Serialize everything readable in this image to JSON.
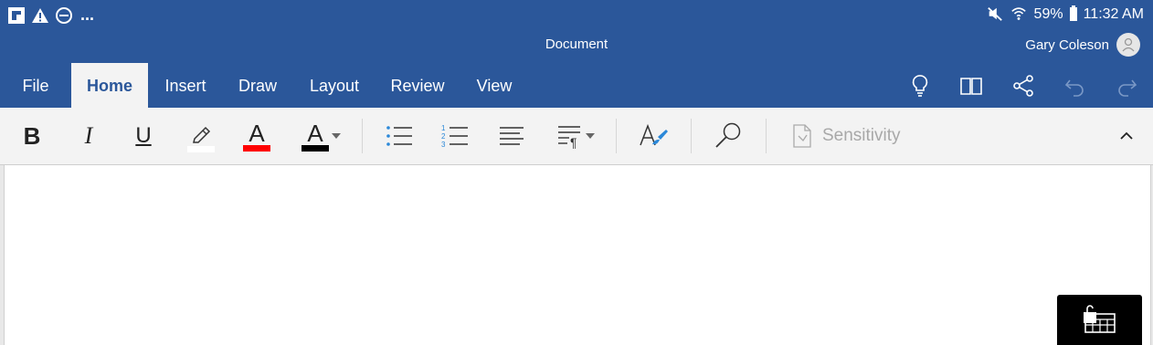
{
  "status_bar": {
    "left_icons": [
      "flipboard-icon",
      "warning-icon",
      "do-not-disturb-icon"
    ],
    "more": "...",
    "battery": "59%",
    "time": "11:32 AM"
  },
  "title_bar": {
    "document_title": "Document",
    "user_name": "Gary Coleson"
  },
  "tabs": [
    {
      "label": "File",
      "active": false
    },
    {
      "label": "Home",
      "active": true
    },
    {
      "label": "Insert",
      "active": false
    },
    {
      "label": "Draw",
      "active": false
    },
    {
      "label": "Layout",
      "active": false
    },
    {
      "label": "Review",
      "active": false
    },
    {
      "label": "View",
      "active": false
    }
  ],
  "tab_bar_icons": [
    "lightbulb-icon",
    "book-icon",
    "share-icon",
    "undo-icon",
    "redo-icon"
  ],
  "ribbon": {
    "bold_glyph": "B",
    "italic_glyph": "I",
    "underline_glyph": "U",
    "font_color_glyph": "A",
    "text_color_glyph": "A",
    "sensitivity_label": "Sensitivity",
    "colors": {
      "highlight": "#ffffff",
      "font_color": "#ff0000",
      "text_color": "#000000"
    }
  },
  "colors": {
    "brand": "#2b579a",
    "ribbon_bg": "#f3f3f3",
    "accent_blue": "#2b88d8"
  }
}
